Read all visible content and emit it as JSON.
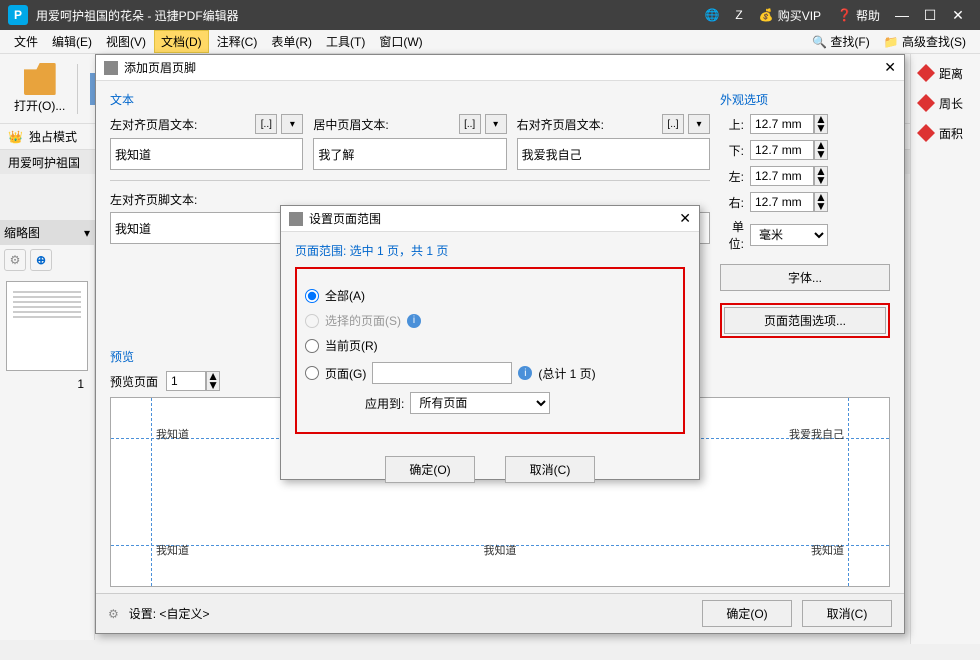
{
  "titlebar": {
    "title": "用爱呵护祖国的花朵 - 迅捷PDF编辑器",
    "z": "Z",
    "vip": "购买VIP",
    "help": "帮助"
  },
  "menu": {
    "file": "文件",
    "edit": "编辑(E)",
    "view": "视图(V)",
    "doc": "文档(D)",
    "comment": "注释(C)",
    "form": "表单(R)",
    "tool": "工具(T)",
    "window": "窗口(W)",
    "search": "查找(F)",
    "adv_search": "高级查找(S)"
  },
  "toolbar": {
    "open": "打开(O)...",
    "exclusive": "独占模式"
  },
  "rightpanel": {
    "dist": "距离",
    "perim": "周长",
    "area": "面积"
  },
  "tab": {
    "name": "用爱呵护祖国"
  },
  "leftpanel": {
    "title": "缩略图",
    "page": "1"
  },
  "modal1": {
    "title": "添加页眉页脚",
    "text_section": "文本",
    "left_header": "左对齐页眉文本:",
    "center_header": "居中页眉文本:",
    "right_header": "右对齐页眉文本:",
    "left_footer": "左对齐页脚文本:",
    "val_left_h": "我知道",
    "val_center_h": "我了解",
    "val_right_h": "我爱我自己",
    "val_left_f": "我知道",
    "appearance": "外观选项",
    "top": "上:",
    "bottom": "下:",
    "left": "左:",
    "right": "右:",
    "margin": "12.7 mm",
    "unit": "单位:",
    "unit_val": "毫米",
    "font_btn": "字体...",
    "range_btn": "页面范围选项...",
    "preview": "预览",
    "preview_page": "预览页面",
    "preview_num": "1",
    "pv_lh": "我知道",
    "pv_rh": "我爱我自己",
    "pv_lf": "我知道",
    "pv_cf": "我知道",
    "pv_rf": "我知道",
    "settings": "设置: <自定义>",
    "ok": "确定(O)",
    "cancel": "取消(C)"
  },
  "modal2": {
    "title": "设置页面范围",
    "info": "页面范围: 选中 1 页，共 1 页",
    "all": "全部(A)",
    "selected": "选择的页面(S)",
    "current": "当前页(R)",
    "pages": "页面(G)",
    "total": "(总计 1 页)",
    "apply": "应用到:",
    "apply_val": "所有页面",
    "ok": "确定(O)",
    "cancel": "取消(C)"
  }
}
